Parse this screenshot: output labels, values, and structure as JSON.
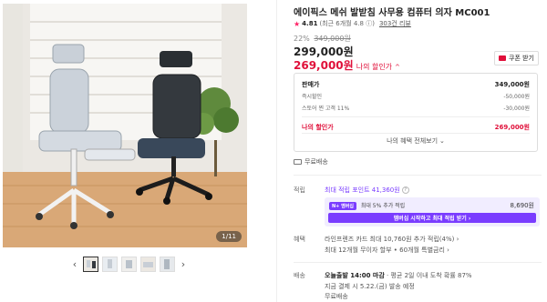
{
  "gallery": {
    "counter": "1/11",
    "prev_arrow": "‹",
    "next_arrow": "›",
    "thumbnail_count": 5
  },
  "product": {
    "title": "에이픽스 메쉬 발받침 사무용 컴퓨터 의자 MC001",
    "rating_star": "★",
    "rating": "4.81",
    "rating_detail": "(최근 6개월 4.8 ⓘ)",
    "review_count": "303건 리뷰",
    "discount_rate": "22%",
    "original_price": "349,000원",
    "price": "299,000원",
    "sale_price": "269,000원",
    "sale_label": "나의 할인가",
    "sale_chevron": "^",
    "coupon_button": "쿠폰 받기"
  },
  "price_breakdown": {
    "rows": [
      {
        "label": "판매가",
        "value": "349,000원"
      },
      {
        "label": "즉시할인",
        "value": "-50,000원"
      },
      {
        "label": "스토어 찐 고객 11%",
        "value": "-30,000원"
      }
    ],
    "final_label": "나의 할인가",
    "final_value": "269,000원",
    "more_button": "나의 혜택 전체보기",
    "more_chevron": "⌄"
  },
  "shipping_top": "무료배송",
  "points": {
    "label": "적립",
    "text": "최대 적립 포인트 41,360원",
    "help": "?"
  },
  "membership": {
    "badge": "N+ 멤버십",
    "text": "최대 5% 추가 적립",
    "amount": "8,690원",
    "button": "멤버십 시작하고 최대 적립 받기 ›"
  },
  "benefits": {
    "label": "혜택",
    "line1": "라인프렌즈 카드 최대 10,760원 추가 적립(4%) ›",
    "line2": "최대 12개월 무이자 할부 • 60개월 특별금리 ›"
  },
  "delivery": {
    "label": "배송",
    "line1_bold": "오늘출발 14:00 마감",
    "line1_rest": "· 평균 2일 이내 도착 확률 87%",
    "line2": "지금 결제 시 5.22.(금) 발송 예정",
    "line3": "무료배송"
  },
  "colors": {
    "accent_red": "#e0103a",
    "membership_purple": "#7a3cff",
    "membership_bg": "#f1edff"
  }
}
